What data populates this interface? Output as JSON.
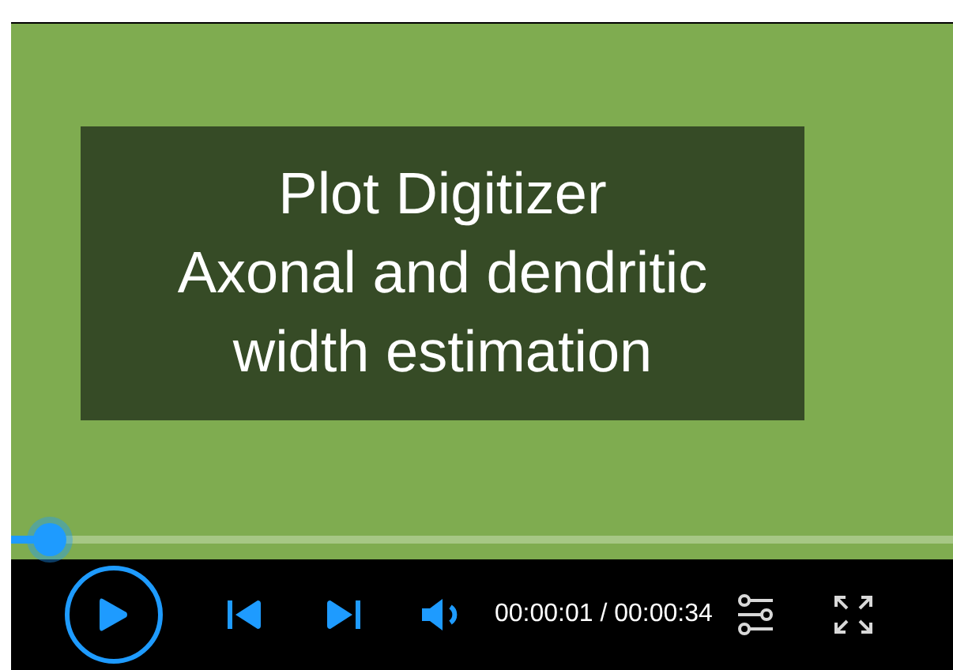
{
  "video": {
    "title_lines": [
      "Plot Digitizer",
      "Axonal and dendritic",
      "width estimation"
    ]
  },
  "progress": {
    "level": 0.04
  },
  "controls": {
    "playing": false,
    "time": "00:00:01 / 00:00:34"
  }
}
